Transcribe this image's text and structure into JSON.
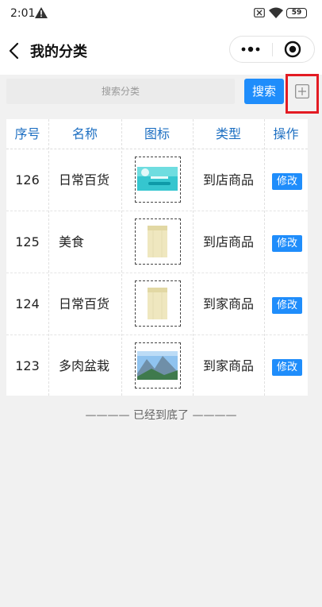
{
  "status_bar": {
    "time": "2:01",
    "battery": "59",
    "icons": [
      "warning-icon",
      "sim-x-icon",
      "wifi-icon",
      "battery-icon"
    ]
  },
  "nav": {
    "title": "我的分类",
    "icons": [
      "back-icon",
      "more-icon",
      "close-circle-icon"
    ]
  },
  "search": {
    "placeholder": "搜索分类",
    "button_label": "搜索",
    "add_icon": "plus-square-icon",
    "highlight_color": "#e31b23"
  },
  "table": {
    "headers": [
      "序号",
      "名称",
      "图标",
      "类型",
      "操作"
    ],
    "rows": [
      {
        "id": "126",
        "name": "日常百货",
        "icon": "banner-image",
        "type": "到店商品",
        "action": "修改"
      },
      {
        "id": "125",
        "name": "美食",
        "icon": "towel-image",
        "type": "到店商品",
        "action": "修改"
      },
      {
        "id": "124",
        "name": "日常百货",
        "icon": "towel-image",
        "type": "到家商品",
        "action": "修改"
      },
      {
        "id": "123",
        "name": "多肉盆栽",
        "icon": "mountain-landscape-image",
        "type": "到家商品",
        "action": "修改"
      }
    ]
  },
  "footer": {
    "end_text": "———— 已经到底了 ————"
  },
  "colors": {
    "accent": "#1f8dfb",
    "header_text": "#1d6fc2",
    "background": "#f1f1f1"
  }
}
